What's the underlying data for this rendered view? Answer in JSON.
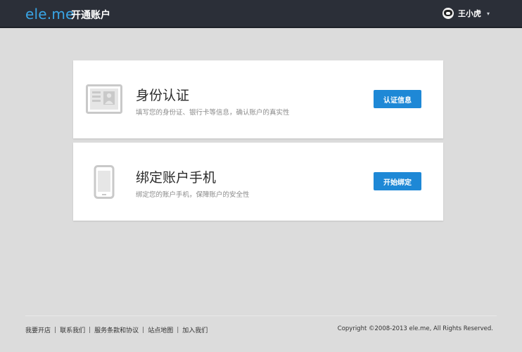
{
  "header": {
    "logo": "ele.me",
    "title": "开通账户",
    "user_name": "王小虎",
    "user_caret": "▾"
  },
  "cards": [
    {
      "title": "身份认证",
      "description": "填写您的身份证、银行卡等信息，确认账户的真实性",
      "button": "认证信息",
      "icon": "id-card-icon"
    },
    {
      "title": "绑定账户手机",
      "description": "绑定您的账户手机，保障账户的安全性",
      "button": "开始绑定",
      "icon": "mobile-phone-icon"
    }
  ],
  "footer": {
    "links": [
      "我要开店",
      "联系我们",
      "服务条款和协议",
      "站点地图",
      "加入我们"
    ],
    "separator": "|",
    "copyright": "Copyright ©2008-2013 ele.me, All Rights Reserved."
  },
  "colors": {
    "topbar": "#2b2f38",
    "logo": "#39a5e6",
    "button": "#1e88d6",
    "background": "#dcdcdc"
  }
}
